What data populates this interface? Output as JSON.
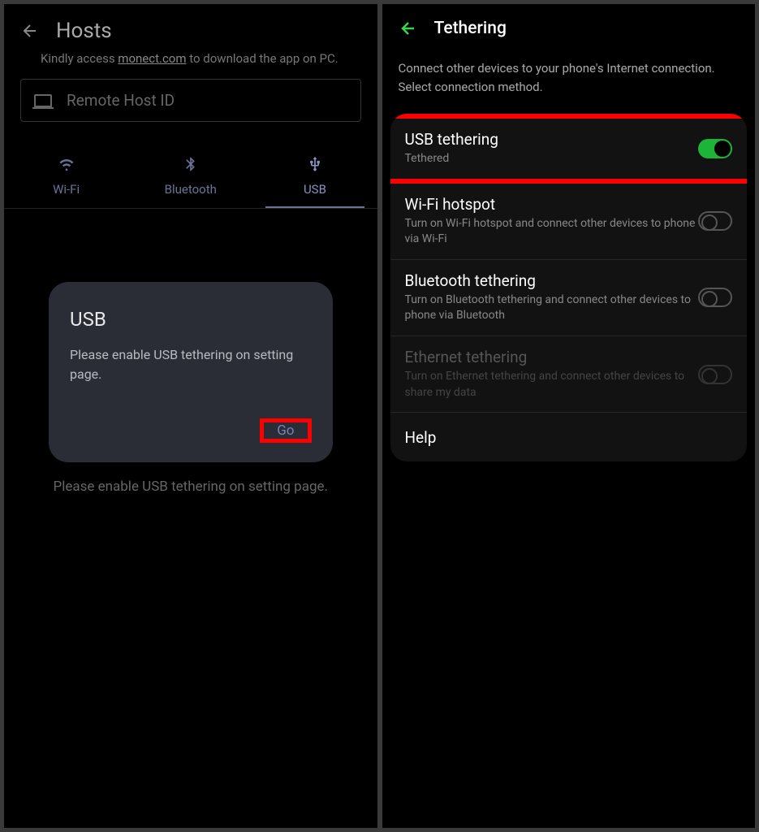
{
  "left": {
    "title": "Hosts",
    "hint_prefix": "Kindly access ",
    "hint_link": "monect.com",
    "hint_suffix": " to download the app on PC.",
    "input_placeholder": "Remote Host ID",
    "tabs": [
      {
        "label": "Wi-Fi"
      },
      {
        "label": "Bluetooth"
      },
      {
        "label": "USB"
      }
    ],
    "dialog": {
      "title": "USB",
      "text": "Please enable USB tethering on setting page.",
      "action": "Go"
    },
    "bottom_hint": "Please enable USB tethering on setting page."
  },
  "right": {
    "title": "Tethering",
    "description": "Connect other devices to your phone's Internet connection. Select connection method.",
    "settings": [
      {
        "title": "USB tethering",
        "sub": "Tethered",
        "toggle": "on",
        "highlighted": true
      },
      {
        "title": "Wi-Fi hotspot",
        "sub": "Turn on Wi-Fi hotspot and connect other devices to phone via Wi-Fi",
        "toggle": "off"
      },
      {
        "title": "Bluetooth tethering",
        "sub": "Turn on Bluetooth tethering and connect other devices to phone via Bluetooth",
        "toggle": "off"
      },
      {
        "title": "Ethernet tethering",
        "sub": "Turn on Ethernet tethering and connect other devices to share my data",
        "toggle": "disabled",
        "disabled": true
      },
      {
        "title": "Help"
      }
    ]
  }
}
